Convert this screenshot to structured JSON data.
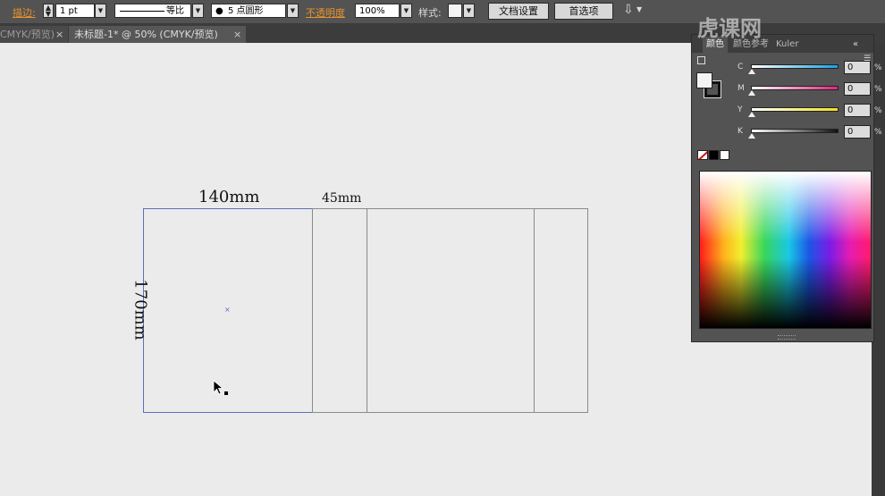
{
  "control_bar": {
    "stroke_label": "描边:",
    "stroke_weight": "1 pt",
    "profile_label": "等比",
    "brush_label": "5 点圆形",
    "opacity_label": "不透明度",
    "opacity_value": "100%",
    "style_label": "样式:",
    "doc_setup_label": "文档设置",
    "preferences_label": "首选项"
  },
  "tabs": [
    {
      "label": "CMYK/预览)",
      "close": "×"
    },
    {
      "label": "未标题-1* @ 50% (CMYK/预览)",
      "close": "×"
    }
  ],
  "drawing": {
    "width_label": "140mm",
    "width2_label": "45mm",
    "height_label": "170mm"
  },
  "color_panel": {
    "tab_color": "颜色",
    "tab_guide": "颜色参考",
    "tab_kuler": "Kuler",
    "channels": [
      {
        "letter": "C",
        "value": "0",
        "unit": "%",
        "level": 0,
        "color": "#1aa0e0"
      },
      {
        "letter": "M",
        "value": "0",
        "unit": "%",
        "level": 0,
        "color": "#e0247a"
      },
      {
        "letter": "Y",
        "value": "0",
        "unit": "%",
        "level": 0,
        "color": "#f0e020"
      },
      {
        "letter": "K",
        "value": "0",
        "unit": "%",
        "level": 0,
        "color": "#111111"
      }
    ]
  },
  "watermark": "虎课网"
}
